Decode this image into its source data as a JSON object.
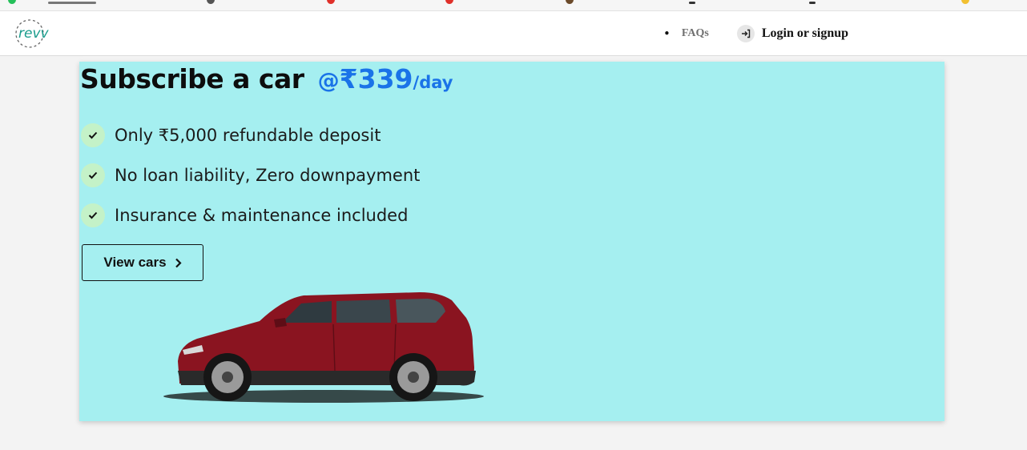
{
  "header": {
    "faq_label": "FAQs",
    "login_label": "Login or signup"
  },
  "hero": {
    "title_main": "Subscribe a car",
    "title_at": "@",
    "price": "₹339",
    "price_unit": "/day",
    "features": [
      "Only ₹5,000 refundable deposit",
      "No loan liability, Zero downpayment",
      "Insurance & maintenance included"
    ],
    "cta_label": "View cars"
  },
  "colors": {
    "hero_bg": "#a5eff0",
    "accent_blue": "#1a73e8",
    "logo_green": "#1a9c8c",
    "car_red": "#8a1420",
    "check_bg": "#c4f2c8"
  },
  "icons": {
    "logo": "revv-logo",
    "login": "login-arrow-icon",
    "check": "check-icon",
    "cta": "chevron-right-icon"
  }
}
